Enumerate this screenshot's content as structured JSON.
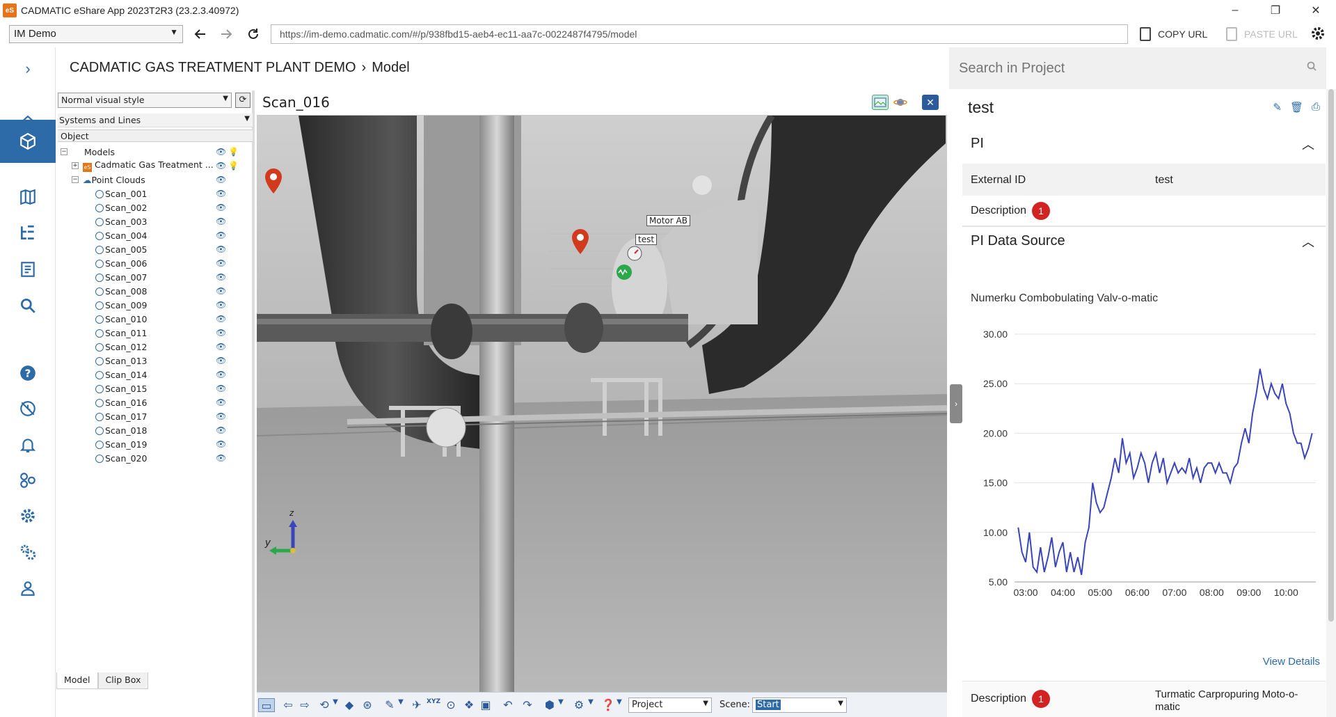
{
  "window": {
    "title": "CADMATIC eShare App 2023T2R3 (23.2.3.40972)",
    "logo_text": "eS",
    "minimize": "–",
    "restore": "❐",
    "close": "✕"
  },
  "addressbar": {
    "project": "IM Demo",
    "url": "https://im-demo.cadmatic.com/#/p/938fbd15-aeb4-ec11-aa7c-0022487f4795/model",
    "copy_url": "COPY URL",
    "paste_url": "PASTE URL"
  },
  "sidebar": {
    "expand": "›",
    "items": [
      "home-icon",
      "model-cube-icon",
      "map-icon",
      "hierarchy-icon",
      "document-icon",
      "search-icon",
      "help-icon",
      "offline-icon",
      "bell-icon",
      "integrations-icon",
      "settings-icon",
      "admin-settings-icon",
      "user-icon"
    ]
  },
  "breadcrumb": {
    "project": "CADMATIC GAS TREATMENT PLANT DEMO",
    "separator": "›",
    "page": "Model"
  },
  "tree_panel": {
    "visual_style": "Normal visual style",
    "systems": "Systems and Lines",
    "column": "Object",
    "root": "Models",
    "model": "Cadmatic Gas Treatment ...",
    "model_icon": "eS",
    "point_clouds": "Point Clouds",
    "scans": [
      "Scan_001",
      "Scan_002",
      "Scan_003",
      "Scan_004",
      "Scan_005",
      "Scan_006",
      "Scan_007",
      "Scan_008",
      "Scan_009",
      "Scan_010",
      "Scan_011",
      "Scan_012",
      "Scan_013",
      "Scan_014",
      "Scan_015",
      "Scan_016",
      "Scan_017",
      "Scan_018",
      "Scan_019",
      "Scan_020"
    ],
    "tabs": [
      "Model",
      "Clip Box"
    ]
  },
  "viewer": {
    "title": "Scan_016",
    "labels": {
      "motor": "Motor AB",
      "test": "test"
    },
    "axis": {
      "y": "y",
      "z": "z"
    },
    "toolbar": {
      "coord_select": "Project",
      "scene_label": "Scene:",
      "scene_value": "Start",
      "xyz": "XYZ"
    }
  },
  "search": {
    "placeholder": "Search in Project"
  },
  "details": {
    "title": "test",
    "pi": {
      "header": "PI",
      "external_id_label": "External ID",
      "external_id": "test",
      "description_label": "Description",
      "description_badge": "1"
    },
    "pi_source": {
      "header": "PI Data Source",
      "name": "Numerku Combobulating Valv-o-matic",
      "view_details": "View Details",
      "description_label": "Description",
      "description_badge": "1",
      "description": "Turmatic Carpropuring Moto-o-matic"
    }
  },
  "chart_data": {
    "type": "line",
    "title": "Numerku Combobulating Valv-o-matic",
    "xlabel": "",
    "ylabel": "",
    "x_ticks": [
      "03:00",
      "04:00",
      "05:00",
      "06:00",
      "07:00",
      "08:00",
      "09:00",
      "10:00"
    ],
    "y_ticks": [
      "5.00",
      "10.00",
      "15.00",
      "20.00",
      "25.00",
      "30.00"
    ],
    "ylim": [
      5,
      30
    ],
    "xlim": [
      2.7,
      10.8
    ],
    "grid": "horizontal",
    "color": "#3a46b8",
    "series": [
      {
        "x": [
          2.8,
          2.9,
          3.0,
          3.1,
          3.2,
          3.3,
          3.4,
          3.5,
          3.6,
          3.7,
          3.8,
          3.9,
          4.0,
          4.1,
          4.2,
          4.3,
          4.4,
          4.5,
          4.6,
          4.7,
          4.8,
          4.9,
          5.0,
          5.1,
          5.2,
          5.3,
          5.4,
          5.5,
          5.6,
          5.7,
          5.8,
          5.9,
          6.0,
          6.1,
          6.2,
          6.3,
          6.4,
          6.5,
          6.6,
          6.7,
          6.8,
          6.9,
          7.0,
          7.1,
          7.2,
          7.3,
          7.4,
          7.5,
          7.6,
          7.7,
          7.8,
          7.9,
          8.0,
          8.1,
          8.2,
          8.3,
          8.4,
          8.5,
          8.6,
          8.7,
          8.8,
          8.9,
          9.0,
          9.1,
          9.2,
          9.3,
          9.4,
          9.5,
          9.6,
          9.7,
          9.8,
          9.9,
          10.0,
          10.1,
          10.2,
          10.3,
          10.4,
          10.5,
          10.6,
          10.7
        ],
        "y": [
          10.5,
          8.0,
          7.0,
          10.0,
          6.5,
          6.0,
          8.5,
          6.0,
          7.5,
          9.5,
          6.5,
          8.0,
          9.0,
          6.0,
          8.0,
          6.0,
          7.5,
          5.7,
          9.0,
          10.5,
          15.0,
          13.0,
          12.0,
          12.5,
          14.0,
          15.5,
          17.5,
          16.0,
          19.5,
          17.0,
          18.0,
          15.5,
          16.5,
          18.0,
          17.0,
          15.0,
          17.0,
          18.0,
          16.0,
          17.5,
          15.0,
          16.0,
          17.0,
          16.0,
          16.5,
          16.0,
          17.5,
          15.5,
          16.5,
          15.0,
          16.5,
          17.0,
          17.0,
          16.0,
          17.0,
          16.0,
          16.0,
          15.0,
          16.5,
          17.0,
          19.0,
          20.5,
          19.0,
          22.0,
          24.0,
          26.5,
          24.5,
          23.5,
          25.0,
          24.0,
          23.5,
          25.0,
          23.0,
          22.0,
          20.0,
          19.0,
          19.0,
          17.5,
          18.5,
          20.0
        ]
      }
    ]
  }
}
